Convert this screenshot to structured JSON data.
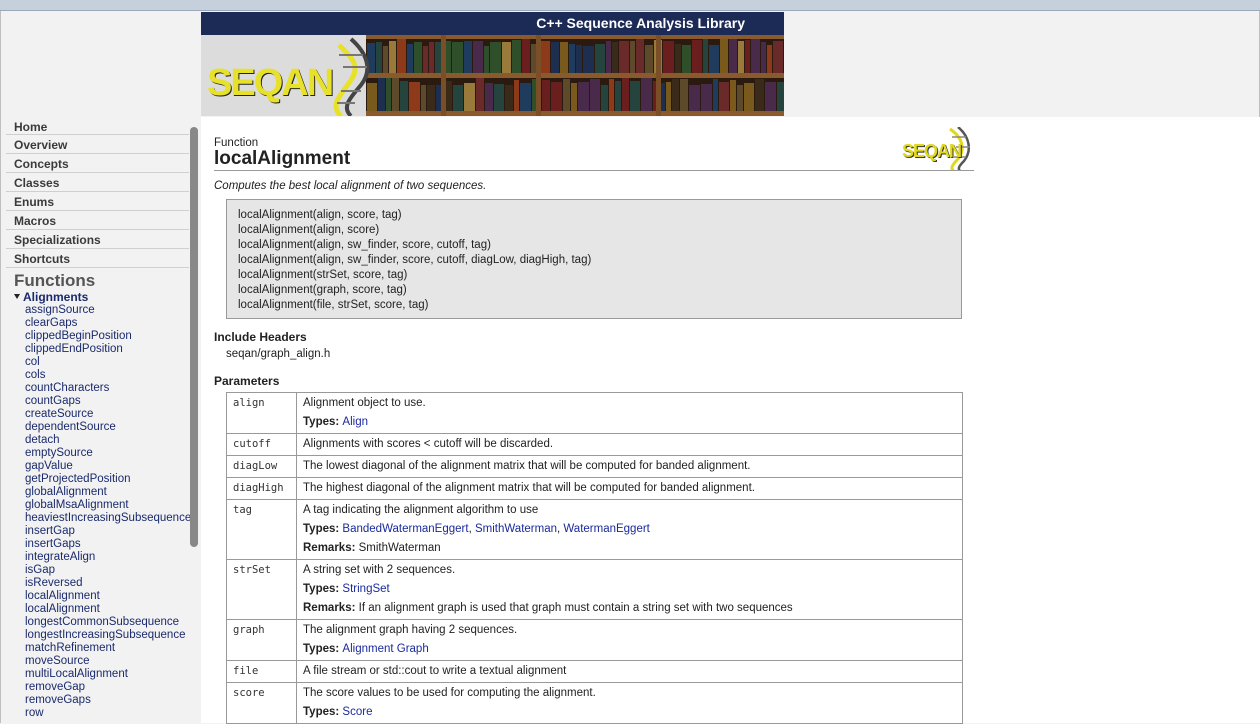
{
  "banner": {
    "title": "C++ Sequence Analysis Library",
    "logo_text": "SEQAN"
  },
  "sidebar": {
    "nav": [
      "Home",
      "Overview",
      "Concepts",
      "Classes",
      "Enums",
      "Macros",
      "Specializations",
      "Shortcuts"
    ],
    "section_title": "Functions",
    "group": "Alignments",
    "functions": [
      "assignSource",
      "clearGaps",
      "clippedBeginPosition",
      "clippedEndPosition",
      "col",
      "cols",
      "countCharacters",
      "countGaps",
      "createSource",
      "dependentSource",
      "detach",
      "emptySource",
      "gapValue",
      "getProjectedPosition",
      "globalAlignment",
      "globalMsaAlignment",
      "heaviestIncreasingSubsequence",
      "insertGap",
      "insertGaps",
      "integrateAlign",
      "isGap",
      "isReversed",
      "localAlignment",
      "localAlignment",
      "longestCommonSubsequence",
      "longestIncreasingSubsequence",
      "matchRefinement",
      "moveSource",
      "multiLocalAlignment",
      "removeGap",
      "removeGaps",
      "row"
    ]
  },
  "page": {
    "kind": "Function",
    "title": "localAlignment",
    "logo_text": "SEQAN",
    "summary": "Computes the best local alignment of two sequences.",
    "signatures": [
      "localAlignment(align, score, tag)",
      "localAlignment(align, score)",
      "localAlignment(align, sw_finder, score, cutoff, tag)",
      "localAlignment(align, sw_finder, score, cutoff, diagLow, diagHigh, tag)",
      "localAlignment(strSet, score, tag)",
      "localAlignment(graph, score, tag)",
      "localAlignment(file, strSet, score, tag)"
    ],
    "include_heading": "Include Headers",
    "include_file": "seqan/graph_align.h",
    "params_heading": "Parameters",
    "types_label": "Types:",
    "remarks_label": "Remarks:",
    "params": [
      {
        "name": "align",
        "desc": "Alignment object to use.",
        "types": [
          "Align"
        ],
        "remarks": ""
      },
      {
        "name": "cutoff",
        "desc": "Alignments with scores < cutoff will be discarded.",
        "types": [],
        "remarks": ""
      },
      {
        "name": "diagLow",
        "desc": "The lowest diagonal of the alignment matrix that will be computed for banded alignment.",
        "types": [],
        "remarks": ""
      },
      {
        "name": "diagHigh",
        "desc": "The highest diagonal of the alignment matrix that will be computed for banded alignment.",
        "types": [],
        "remarks": ""
      },
      {
        "name": "tag",
        "desc": "A tag indicating the alignment algorithm to use",
        "types": [
          "BandedWatermanEggert",
          "SmithWaterman",
          "WatermanEggert"
        ],
        "remarks": "SmithWaterman"
      },
      {
        "name": "strSet",
        "desc": "A string set with 2 sequences.",
        "types": [
          "StringSet"
        ],
        "remarks": "If an alignment graph is used that graph must contain a string set with two sequences"
      },
      {
        "name": "graph",
        "desc": "The alignment graph having 2 sequences.",
        "types": [
          "Alignment Graph"
        ],
        "remarks": ""
      },
      {
        "name": "file",
        "desc": "A file stream or std::cout to write a textual alignment",
        "types": [],
        "remarks": ""
      },
      {
        "name": "score",
        "desc": "The score values to be used for computing the alignment.",
        "types": [
          "Score"
        ],
        "remarks": ""
      }
    ]
  }
}
